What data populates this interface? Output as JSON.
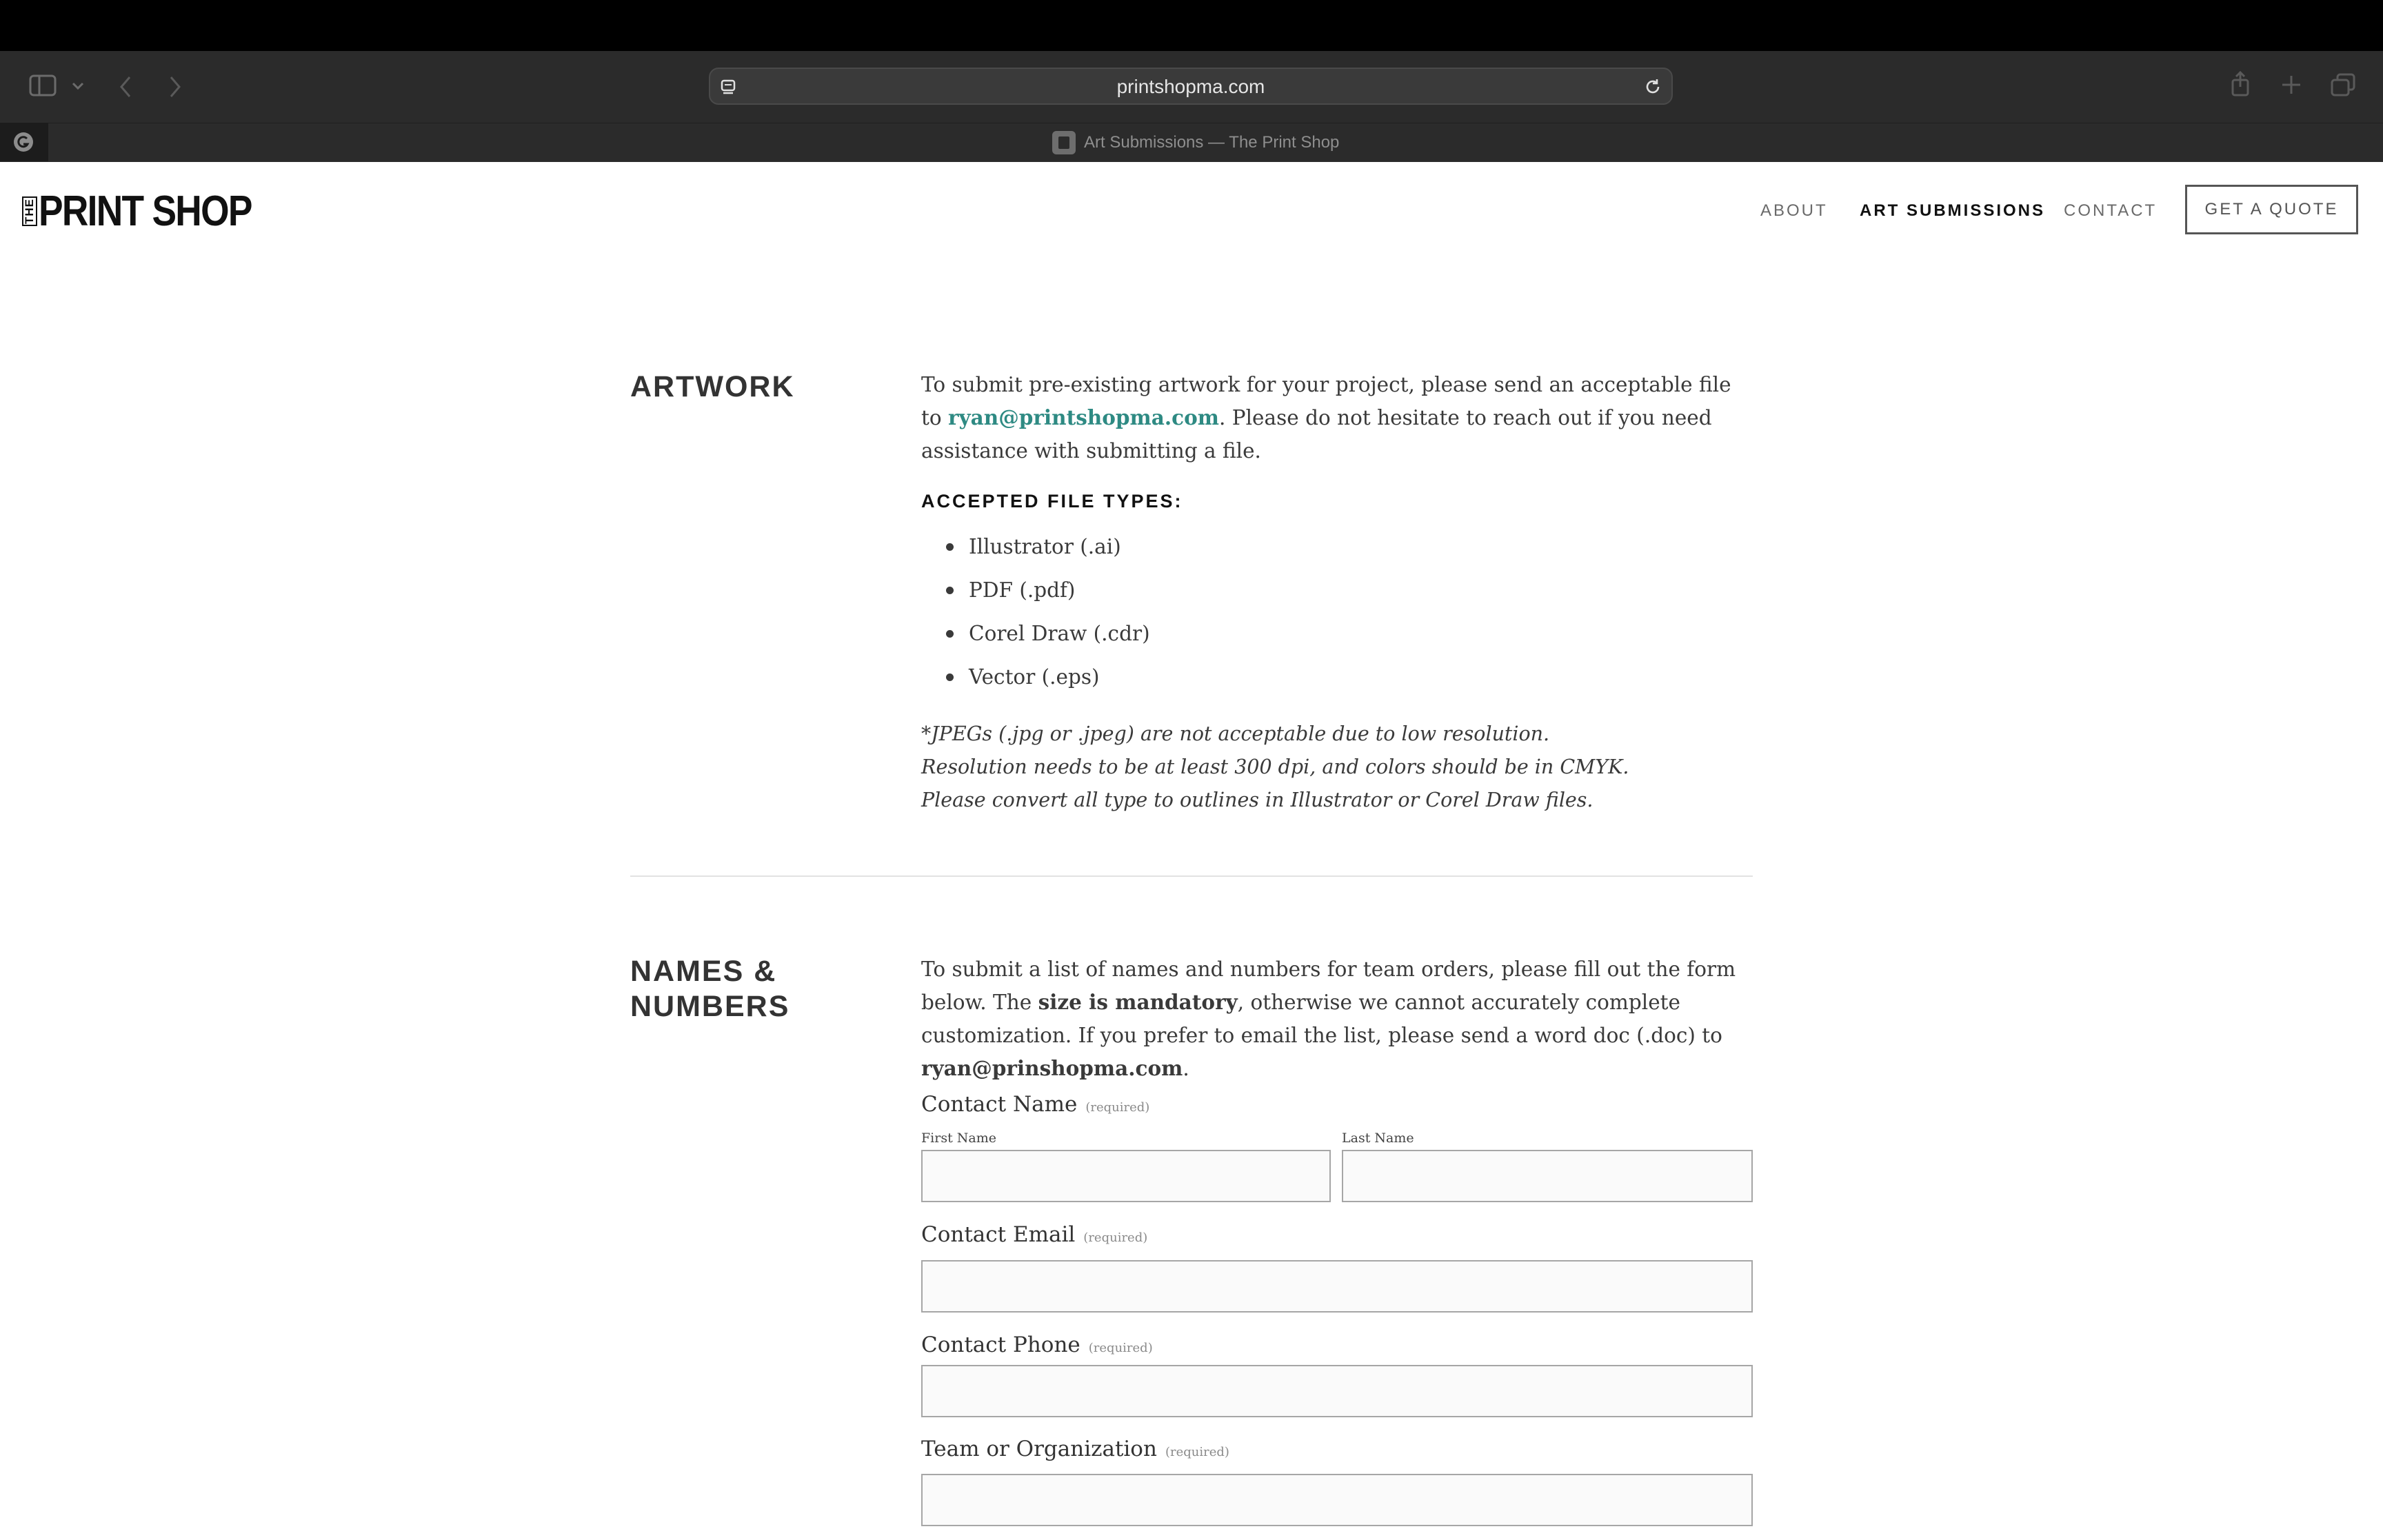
{
  "browser": {
    "url": "printshopma.com",
    "tab_title": "Art Submissions — The Print Shop",
    "icons": [
      "sidebar-icon",
      "chevron-down-icon",
      "back-icon",
      "forward-icon",
      "page-icon",
      "reload-icon",
      "share-icon",
      "new-tab-icon",
      "tabs-overview-icon",
      "extension-icon",
      "favicon"
    ]
  },
  "site": {
    "logo_small": "THE",
    "logo_name": "PRINT SHOP",
    "nav": {
      "about": "ABOUT",
      "art_submissions": "ART SUBMISSIONS",
      "contact": "CONTACT",
      "quote": "GET A QUOTE"
    }
  },
  "artwork": {
    "title": "ARTWORK",
    "intro_before": "To submit pre-existing artwork for your project, please send an acceptable file to ",
    "email": "ryan@printshopma.com",
    "intro_after": ". Please do not hesitate to reach out if you need assistance with submitting a file.",
    "file_types_heading": "ACCEPTED FILE TYPES:",
    "file_types": [
      "Illustrator (.ai)",
      "PDF (.pdf)",
      "Corel Draw (.cdr)",
      "Vector (.eps)"
    ],
    "notes": [
      "*JPEGs (.jpg or .jpeg) are not acceptable due to low resolution.",
      "Resolution needs to be at least 300 dpi, and colors should be in CMYK.",
      "Please convert all type to outlines in Illustrator or Corel Draw files."
    ]
  },
  "names": {
    "title_line1": "NAMES &",
    "title_line2": "NUMBERS",
    "intro_part1": "To submit a list of names and numbers for team orders, please fill out the form below. The ",
    "intro_bold1": "size is mandatory",
    "intro_part2": ", otherwise we cannot accurately complete customization. If you prefer to email the list, please send a word doc (.doc) to ",
    "intro_email": "ryan@prinshopma.com",
    "intro_end": "."
  },
  "form": {
    "required": "(required)",
    "contact_name": "Contact Name",
    "first_name": "First Name",
    "last_name": "Last Name",
    "contact_email": "Contact Email",
    "contact_phone": "Contact Phone",
    "team": "Team or Organization"
  },
  "colors": {
    "link": "#2e8a83",
    "chrome": "#2b2b2b"
  }
}
